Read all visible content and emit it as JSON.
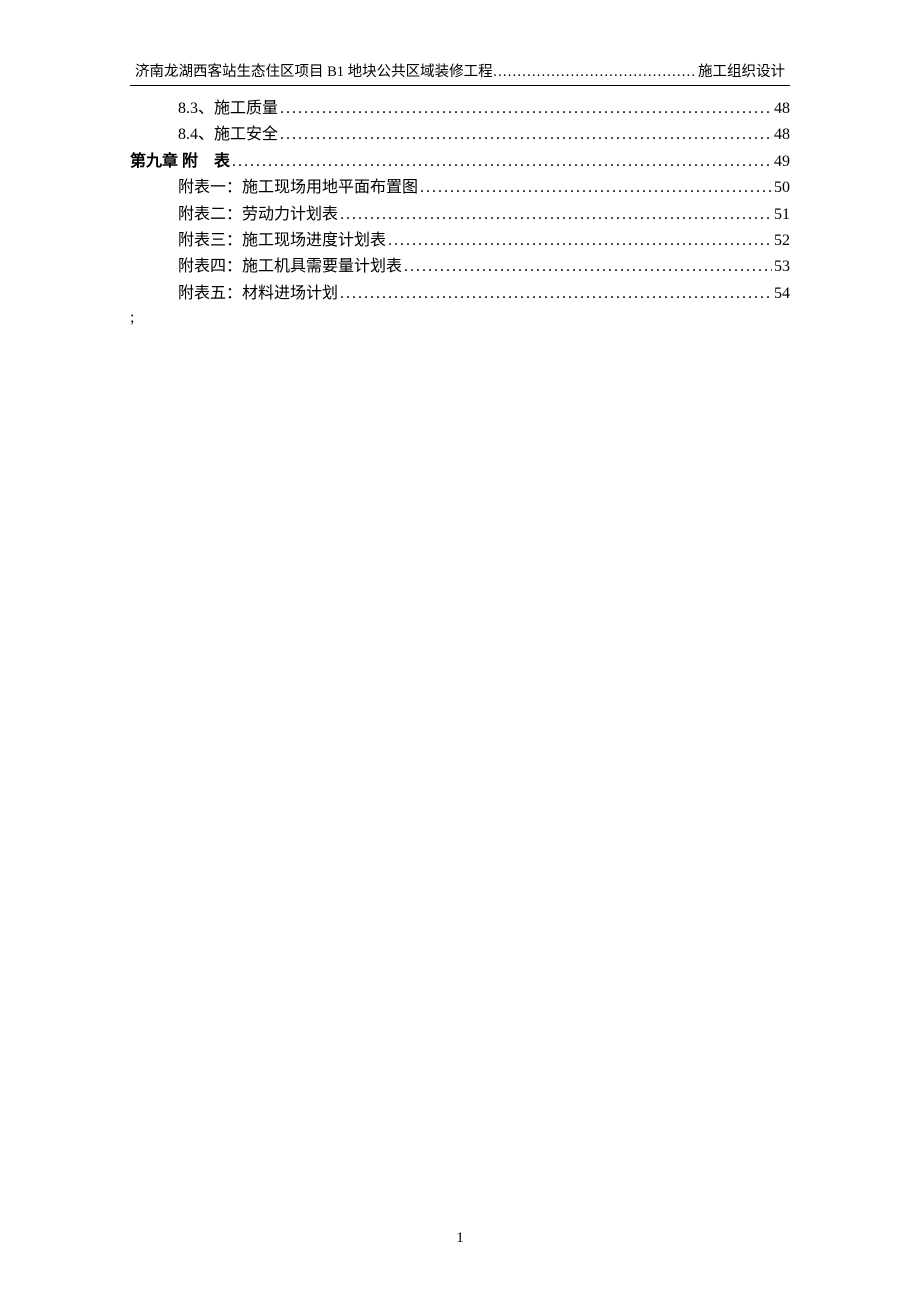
{
  "header": {
    "left": "济南龙湖西客站生态住区项目 B1 地块公共区域装修工程",
    "dots": "……………………………………",
    "right": "施工组织设计"
  },
  "toc": [
    {
      "indent": 2,
      "bold": false,
      "label": "8.3、施工质量",
      "page": "48"
    },
    {
      "indent": 2,
      "bold": false,
      "label": "8.4、施工安全",
      "page": "48"
    },
    {
      "indent": 1,
      "bold": true,
      "label": "第九章 附 表",
      "page": "49"
    },
    {
      "indent": 2,
      "bold": false,
      "label": "附表一：施工现场用地平面布置图",
      "page": "50"
    },
    {
      "indent": 2,
      "bold": false,
      "label": "附表二：劳动力计划表",
      "page": "51"
    },
    {
      "indent": 2,
      "bold": false,
      "label": "附表三：施工现场进度计划表",
      "page": "52"
    },
    {
      "indent": 2,
      "bold": false,
      "label": "附表四：施工机具需要量计划表",
      "page": "53"
    },
    {
      "indent": 2,
      "bold": false,
      "label": "附表五：材料进场计划",
      "page": "54"
    }
  ],
  "stray": ";",
  "dots_fill": "..................................................................................................................................................................................................................",
  "page_number": "1"
}
